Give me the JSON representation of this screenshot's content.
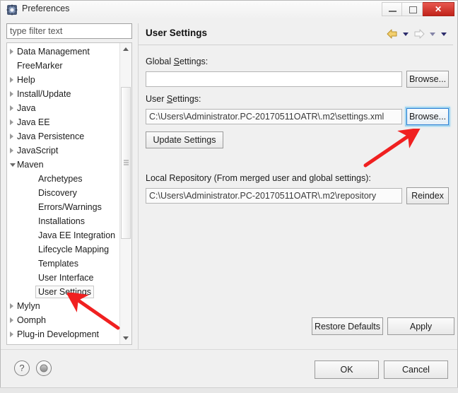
{
  "window": {
    "title": "Preferences",
    "icon": "preferences-gear-icon",
    "controls": {
      "minimize": "minimize-icon",
      "maximize": "maximize-icon",
      "close": "✕"
    }
  },
  "sidebar": {
    "filter": {
      "placeholder": "type filter text",
      "value": ""
    },
    "items": [
      {
        "label": "Data Management",
        "state": "collapsed",
        "level": 0
      },
      {
        "label": "FreeMarker",
        "state": "leaf",
        "level": 0
      },
      {
        "label": "Help",
        "state": "collapsed",
        "level": 0
      },
      {
        "label": "Install/Update",
        "state": "collapsed",
        "level": 0
      },
      {
        "label": "Java",
        "state": "collapsed",
        "level": 0
      },
      {
        "label": "Java EE",
        "state": "collapsed",
        "level": 0
      },
      {
        "label": "Java Persistence",
        "state": "collapsed",
        "level": 0
      },
      {
        "label": "JavaScript",
        "state": "collapsed",
        "level": 0
      },
      {
        "label": "Maven",
        "state": "expanded",
        "level": 0
      },
      {
        "label": "Archetypes",
        "state": "leaf",
        "level": 1
      },
      {
        "label": "Discovery",
        "state": "leaf",
        "level": 1
      },
      {
        "label": "Errors/Warnings",
        "state": "leaf",
        "level": 1
      },
      {
        "label": "Installations",
        "state": "leaf",
        "level": 1
      },
      {
        "label": "Java EE Integration",
        "state": "leaf",
        "level": 1
      },
      {
        "label": "Lifecycle Mapping",
        "state": "leaf",
        "level": 1
      },
      {
        "label": "Templates",
        "state": "leaf",
        "level": 1
      },
      {
        "label": "User Interface",
        "state": "leaf",
        "level": 1
      },
      {
        "label": "User Settings",
        "state": "leaf",
        "level": 1,
        "selected": true
      },
      {
        "label": "Mylyn",
        "state": "collapsed",
        "level": 0
      },
      {
        "label": "Oomph",
        "state": "collapsed",
        "level": 0
      },
      {
        "label": "Plug-in Development",
        "state": "collapsed",
        "level": 0
      }
    ]
  },
  "panel": {
    "title": "User Settings",
    "nav": {
      "back_icon": "back-arrow-icon",
      "back_menu_icon": "chevron-down-icon",
      "forward_icon": "forward-arrow-icon",
      "forward_menu_icon": "chevron-down-icon",
      "menu_icon": "chevron-down-icon"
    },
    "global_settings": {
      "label_prefix": "Global ",
      "label_accel": "S",
      "label_suffix": "ettings:",
      "value": "",
      "browse_label": "Browse..."
    },
    "user_settings": {
      "label_prefix": "User ",
      "label_accel": "S",
      "label_suffix": "ettings:",
      "value": "C:\\Users\\Administrator.PC-20170511OATR\\.m2\\settings.xml",
      "browse_label": "Browse...",
      "update_label": "Update Settings"
    },
    "local_repository": {
      "label": "Local Repository (From merged user and global settings):",
      "value": "C:\\Users\\Administrator.PC-20170511OATR\\.m2\\repository",
      "reindex_label": "Reindex"
    },
    "restore_defaults_label": "Restore Defaults",
    "apply_label": "Apply"
  },
  "footer": {
    "help_icon": "?",
    "status_icon": "status-dot-icon",
    "ok_label": "OK",
    "cancel_label": "Cancel"
  },
  "colors": {
    "accent_focus": "#2e7fd4",
    "close_button": "#c0231a",
    "annotation": "#f02020",
    "back_arrow": "#e8b84b"
  }
}
